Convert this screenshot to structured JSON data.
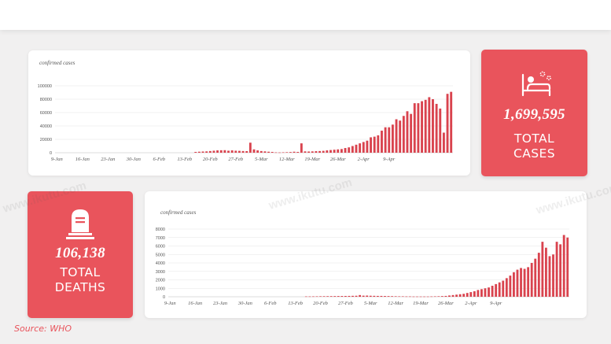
{
  "source_label": "Source: WHO",
  "watermark": "www.ikutu.com",
  "colors": {
    "accent": "#e9545c",
    "bar": "#d9434e",
    "grid": "#e6e6e6"
  },
  "stats": {
    "cases": {
      "value": "1,699,595",
      "line1": "TOTAL",
      "line2": "CASES",
      "icon": "hospital-bed-icon"
    },
    "deaths": {
      "value": "106,138",
      "line1": "TOTAL",
      "line2": "DEATHS",
      "icon": "tombstone-icon"
    }
  },
  "chart_data": [
    {
      "type": "bar",
      "title": "confirmed cases",
      "ylim": [
        0,
        100000
      ],
      "yticks": [
        0,
        20000,
        40000,
        60000,
        80000,
        100000
      ],
      "xtick_labels": [
        "9-Jan",
        "16-Jan",
        "23-Jan",
        "30-Jan",
        "6-Feb",
        "13-Feb",
        "20-Feb",
        "27-Feb",
        "5-Mar",
        "12-Mar",
        "19-Mar",
        "26-Mar",
        "2-Apr",
        "9-Apr"
      ],
      "values": [
        0,
        0,
        0,
        0,
        0,
        0,
        0,
        0,
        0,
        0,
        0,
        0,
        0,
        0,
        0,
        0,
        0,
        0,
        0,
        0,
        0,
        0,
        0,
        0,
        0,
        0,
        0,
        0,
        0,
        0,
        0,
        0,
        0,
        0,
        0,
        0,
        0,
        0,
        1200,
        1500,
        1800,
        2000,
        2500,
        3000,
        3500,
        3700,
        3800,
        3000,
        3500,
        3000,
        2800,
        2500,
        2400,
        15000,
        5000,
        3500,
        2500,
        2000,
        1500,
        1200,
        500,
        400,
        600,
        800,
        1000,
        1500,
        1200,
        14000,
        2000,
        1800,
        2000,
        2300,
        2500,
        2800,
        3500,
        4000,
        4500,
        5000,
        5500,
        7000,
        8000,
        10000,
        12000,
        14000,
        16000,
        18000,
        23000,
        24000,
        26000,
        33000,
        38000,
        38000,
        42000,
        50000,
        48000,
        55000,
        62000,
        58000,
        74000,
        74000,
        77000,
        79000,
        83000,
        80000,
        73000,
        66000,
        30000,
        88000,
        91000
      ]
    },
    {
      "type": "bar",
      "title": "confirmed cases",
      "ylim": [
        0,
        8000
      ],
      "yticks": [
        0,
        1000,
        2000,
        3000,
        4000,
        5000,
        6000,
        7000,
        8000
      ],
      "xtick_labels": [
        "9-Jan",
        "16-Jan",
        "23-Jan",
        "30-Jan",
        "6-Feb",
        "13-Feb",
        "20-Feb",
        "27-Feb",
        "5-Mar",
        "12-Mar",
        "19-Mar",
        "26-Mar",
        "2-Apr",
        "9-Apr"
      ],
      "values": [
        0,
        0,
        0,
        0,
        0,
        0,
        0,
        0,
        0,
        0,
        0,
        0,
        0,
        0,
        0,
        0,
        0,
        0,
        0,
        0,
        0,
        0,
        0,
        0,
        0,
        0,
        0,
        0,
        0,
        0,
        0,
        0,
        0,
        0,
        0,
        0,
        0,
        0,
        40,
        40,
        45,
        50,
        60,
        65,
        70,
        75,
        80,
        85,
        90,
        95,
        100,
        110,
        120,
        200,
        130,
        140,
        120,
        110,
        100,
        100,
        90,
        80,
        70,
        60,
        50,
        50,
        40,
        40,
        30,
        30,
        30,
        30,
        30,
        40,
        50,
        60,
        80,
        100,
        150,
        200,
        250,
        300,
        350,
        450,
        550,
        650,
        800,
        900,
        1000,
        1100,
        1300,
        1500,
        1700,
        1900,
        2200,
        2500,
        2900,
        3200,
        3400,
        3300,
        3500,
        4000,
        4500,
        5200,
        6500,
        5800,
        4800,
        5000,
        6500,
        6200,
        7300,
        7000
      ]
    }
  ]
}
